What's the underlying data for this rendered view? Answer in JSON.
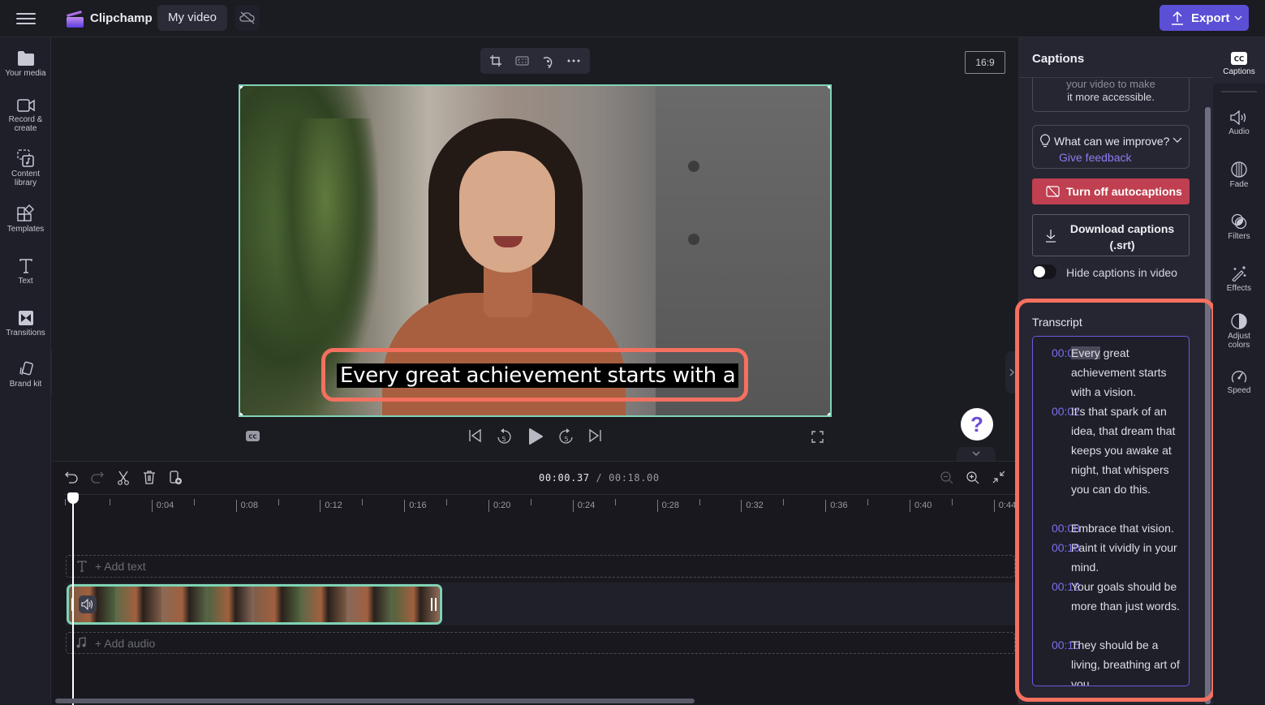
{
  "app": {
    "name": "Clipchamp",
    "project_title": "My video",
    "export_label": "Export"
  },
  "left_sidebar": {
    "items": [
      {
        "label": "Your media",
        "icon": "folder-icon"
      },
      {
        "label": "Record &",
        "label2": "create",
        "icon": "camera-icon"
      },
      {
        "label": "Content",
        "label2": "library",
        "icon": "content-library-icon"
      },
      {
        "label": "Templates",
        "icon": "templates-icon"
      },
      {
        "label": "Text",
        "icon": "text-icon"
      },
      {
        "label": "Transitions",
        "icon": "transitions-icon"
      },
      {
        "label": "Brand kit",
        "icon": "brand-kit-icon"
      }
    ]
  },
  "preview": {
    "aspect_ratio": "16:9",
    "caption_text": "Every great achievement starts with a",
    "toolbar": [
      "crop-icon",
      "fit-icon",
      "rotate-icon",
      "more-icon"
    ]
  },
  "timeline": {
    "current_time": "00:00.37",
    "total_time": "/ 00:18.00",
    "ticks": [
      "0:04",
      "0:08",
      "0:12",
      "0:16",
      "0:20",
      "0:24",
      "0:28",
      "0:32",
      "0:36",
      "0:40",
      "0:44"
    ],
    "add_text": "+ Add text",
    "add_audio": "+ Add audio"
  },
  "captions_panel": {
    "title": "Captions",
    "info_line1": "your video to make",
    "info_line2": "it more accessible.",
    "feedback_question": "What can we improve?",
    "feedback_link": "Give feedback",
    "turn_off_label": "Turn off autocaptions",
    "download_label": "Download captions (.srt)",
    "hide_label": "Hide captions in video",
    "hide_toggle_on": false,
    "transcript_label": "Transcript",
    "transcript": [
      {
        "time": "00:00",
        "first_word": "Every",
        "rest": " great achievement starts with a vision."
      },
      {
        "time": "00:02",
        "text": "It's that spark of an idea, that dream that keeps you awake at night, that whispers you can do this."
      },
      {
        "time": "00:08",
        "text": "Embrace that vision."
      },
      {
        "time": "00:10",
        "text": "Paint it vividly in your mind."
      },
      {
        "time": "00:12",
        "text": "Your goals should be more than just words."
      },
      {
        "time": "00:15",
        "text": "They should be a living, breathing art of you"
      }
    ]
  },
  "right_sidebar": {
    "items": [
      {
        "label": "Captions",
        "icon": "captions-icon",
        "active": true
      },
      {
        "label": "Audio",
        "icon": "audio-icon"
      },
      {
        "label": "Fade",
        "icon": "fade-icon"
      },
      {
        "label": "Filters",
        "icon": "filters-icon"
      },
      {
        "label": "Effects",
        "icon": "effects-icon"
      },
      {
        "label": "Adjust",
        "label2": "colors",
        "icon": "adjust-colors-icon"
      },
      {
        "label": "Speed",
        "icon": "speed-icon"
      }
    ]
  },
  "colors": {
    "accent": "#5b4fd6",
    "danger": "#c03f50",
    "selection": "#7fd3b4",
    "highlight": "#f4705f",
    "timestamp": "#7b6ff0"
  }
}
